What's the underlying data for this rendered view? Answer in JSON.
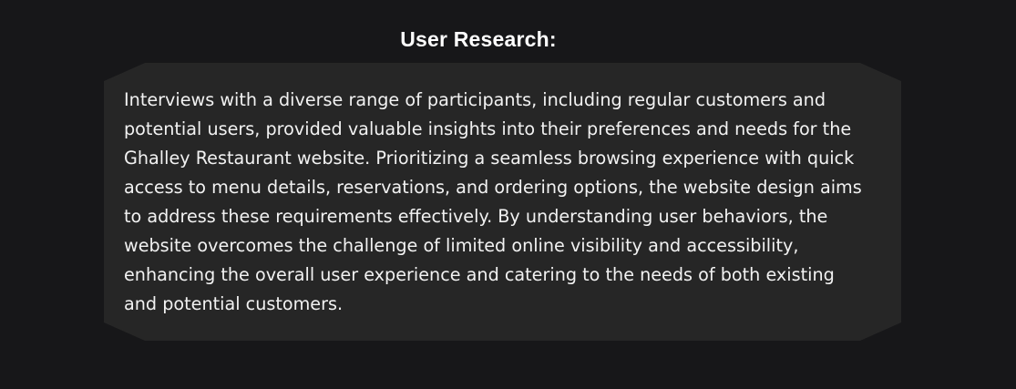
{
  "section": {
    "title": "User Research:",
    "body": "Interviews with a diverse range of participants, including regular customers and potential users, provided valuable insights into their preferences and needs for the Ghalley Restaurant website. Prioritizing a seamless browsing experience with quick access to menu details, reservations, and ordering options, the website design aims to address these requirements effectively. By understanding user behaviors, the website overcomes the challenge of limited online visibility and accessibility, enhancing the overall user experience and catering to the needs of both existing and potential customers."
  },
  "colors": {
    "page_background": "#171719",
    "card_background": "#262626",
    "text": "#f2f2f2",
    "title": "#ffffff"
  }
}
